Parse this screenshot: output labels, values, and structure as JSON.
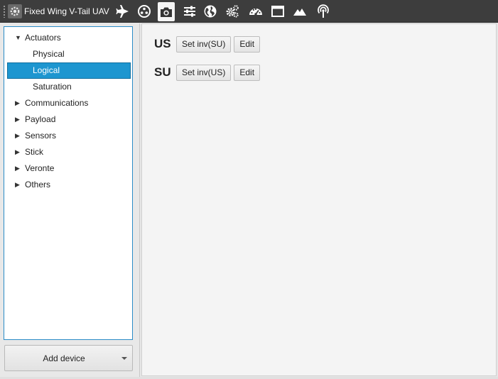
{
  "toolbar": {
    "title": "Fixed Wing V-Tail UAV",
    "icons": [
      "airplane-icon",
      "joystick-icon",
      "camera-icon",
      "sliders-icon",
      "globe-icon",
      "gears-icon",
      "gauge-icon",
      "window-icon",
      "mountain-icon",
      "antenna-icon"
    ],
    "active_icon": "camera-icon"
  },
  "tree": {
    "items": [
      {
        "label": "Actuators",
        "expanded": true
      },
      {
        "label": "Physical"
      },
      {
        "label": "Logical",
        "selected": true
      },
      {
        "label": "Saturation"
      },
      {
        "label": "Communications",
        "expanded": false
      },
      {
        "label": "Payload",
        "expanded": false
      },
      {
        "label": "Sensors",
        "expanded": false
      },
      {
        "label": "Stick",
        "expanded": false
      },
      {
        "label": "Veronte",
        "expanded": false
      },
      {
        "label": "Others",
        "expanded": false
      }
    ]
  },
  "add_device": {
    "label": "Add device"
  },
  "logical": {
    "rows": [
      {
        "name": "US",
        "set_inv": "Set inv(SU)",
        "edit": "Edit"
      },
      {
        "name": "SU",
        "set_inv": "Set inv(US)",
        "edit": "Edit"
      }
    ]
  },
  "colors": {
    "toolbar": "#3d3d3d",
    "selection": "#1d96d0",
    "tree_border": "#2a8cc7"
  }
}
